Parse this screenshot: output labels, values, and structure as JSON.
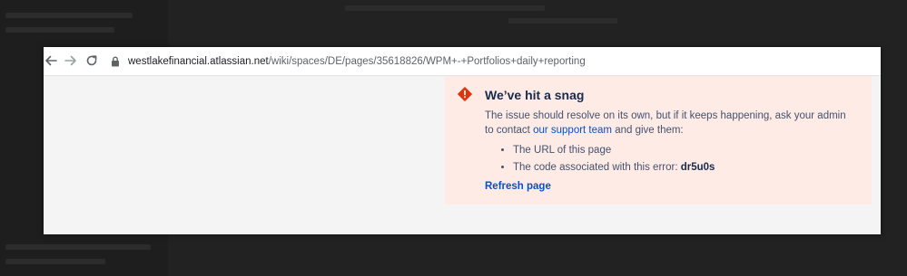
{
  "browser": {
    "url_host": "westlakefinancial.atlassian.net",
    "url_path": "/wiki/spaces/DE/pages/35618826/WPM+-+Portfolios+daily+reporting"
  },
  "error": {
    "title": "We’ve hit a snag",
    "body_before_link": "The issue should resolve on its own, but if it keeps happening, ask your admin to contact ",
    "link_text": "our support team",
    "body_after_link": " and give them:",
    "items": [
      {
        "text": "The URL of this page"
      },
      {
        "text": "The code associated with this error: ",
        "code": "dr5u0s"
      }
    ],
    "refresh_label": "Refresh page"
  },
  "colors": {
    "panel_bg": "#ffebe6",
    "error_icon": "#de350b",
    "link": "#0052cc"
  }
}
